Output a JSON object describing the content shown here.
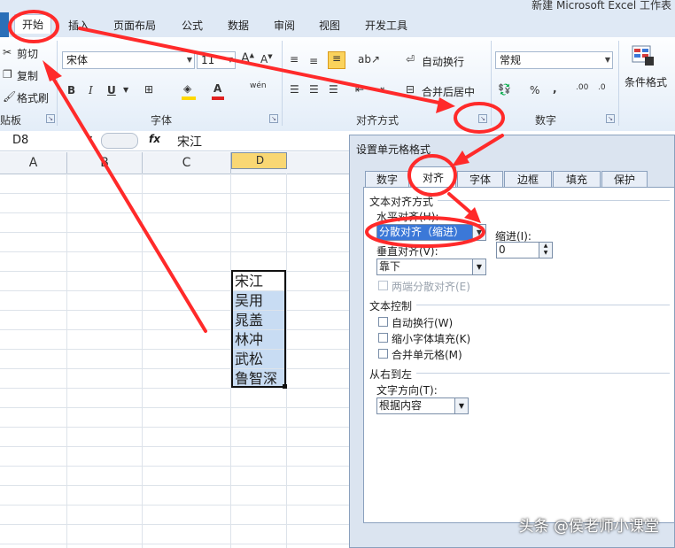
{
  "window": {
    "title": "新建 Microsoft Excel 工作表"
  },
  "ribbon_tabs": [
    {
      "label": "开始"
    },
    {
      "label": "插入"
    },
    {
      "label": "页面布局"
    },
    {
      "label": "公式"
    },
    {
      "label": "数据"
    },
    {
      "label": "审阅"
    },
    {
      "label": "视图"
    },
    {
      "label": "开发工具"
    }
  ],
  "clipboard": {
    "cut": "剪切",
    "copy": "复制",
    "format_painter": "格式刷",
    "group": "剪贴板"
  },
  "font": {
    "name": "宋体",
    "size": "11",
    "bold": "B",
    "italic": "I",
    "underline": "U",
    "font_color_glyph": "A",
    "phonetic": "wén",
    "group": "字体"
  },
  "alignment": {
    "wrap_text": "自动换行",
    "merge_center": "合并后居中",
    "group": "对齐方式"
  },
  "number": {
    "format": "常规",
    "percent": "%",
    "comma": ",",
    "group": "数字"
  },
  "styles": {
    "conditional_format": "条件格式"
  },
  "formula_bar": {
    "name_box": "D8",
    "fx": "fx",
    "content": "宋江"
  },
  "sheet": {
    "columns": [
      "A",
      "B",
      "C",
      "D"
    ],
    "selected_column": "D",
    "cells": [
      "宋江",
      "吴用",
      "晁盖",
      "林冲",
      "武松",
      "鲁智深"
    ]
  },
  "dialog": {
    "title": "设置单元格格式",
    "tabs": [
      {
        "label": "数字"
      },
      {
        "label": "对齐"
      },
      {
        "label": "字体"
      },
      {
        "label": "边框"
      },
      {
        "label": "填充"
      },
      {
        "label": "保护"
      }
    ],
    "text_alignment": "文本对齐方式",
    "horizontal_label": "水平对齐(H):",
    "horizontal_value": "分散对齐（缩进）",
    "indent_label": "缩进(I):",
    "indent_value": "0",
    "vertical_label": "垂直对齐(V):",
    "vertical_value": "靠下",
    "justify_distributed": "两端分散对齐(E)",
    "text_control": "文本控制",
    "wrap_text": "自动换行(W)",
    "shrink_to_fit": "缩小字体填充(K)",
    "merge_cells": "合并单元格(M)",
    "right_to_left": "从右到左",
    "text_direction_label": "文字方向(T):",
    "text_direction_value": "根据内容"
  },
  "watermark": "头条 @侯老师小课堂",
  "colors": {
    "annotation": "#ff2a2a",
    "selected_fill": "#c8dcf3",
    "highlight_blue": "#3b78d8"
  }
}
